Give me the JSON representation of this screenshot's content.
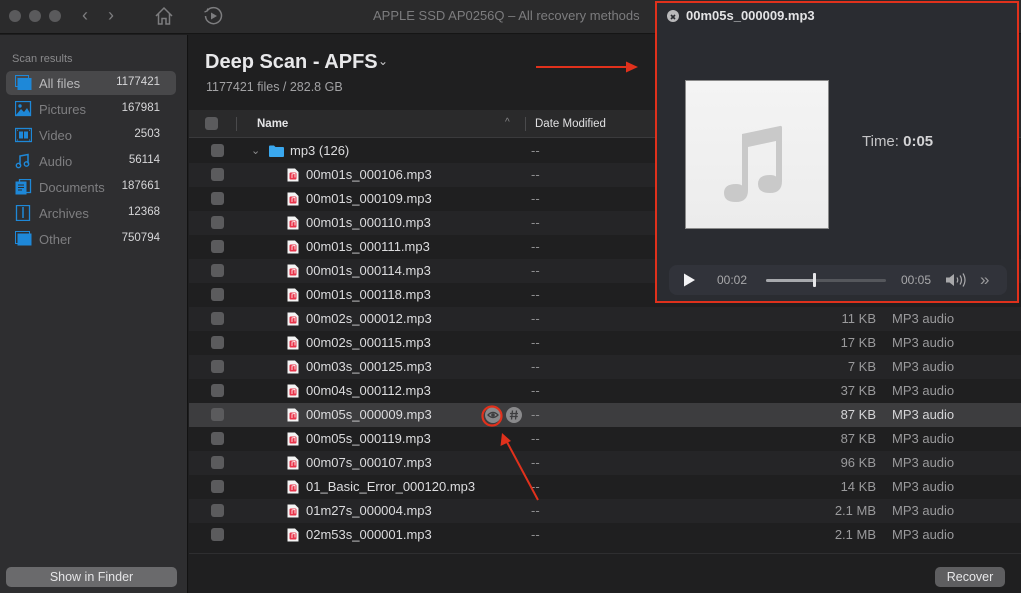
{
  "window": {
    "title": "APPLE SSD AP0256Q – All recovery methods",
    "back_icon": "chevron-left-icon",
    "forward_icon": "chevron-right-icon",
    "home_icon": "home-icon",
    "resume_icon": "play-circle-icon"
  },
  "sidebar": {
    "heading": "Scan results",
    "items": [
      {
        "label": "All files",
        "count": "1177421",
        "icon": "all-files-icon",
        "active": true
      },
      {
        "label": "Pictures",
        "count": "167981",
        "icon": "pictures-icon"
      },
      {
        "label": "Video",
        "count": "2503",
        "icon": "video-icon"
      },
      {
        "label": "Audio",
        "count": "56114",
        "icon": "audio-icon"
      },
      {
        "label": "Documents",
        "count": "187661",
        "icon": "documents-icon"
      },
      {
        "label": "Archives",
        "count": "12368",
        "icon": "archives-icon"
      },
      {
        "label": "Other",
        "count": "750794",
        "icon": "other-icon"
      }
    ],
    "show_in_finder": "Show in Finder"
  },
  "main": {
    "title": "Deep Scan - APFS",
    "title_chevron": "⌄",
    "subtitle": "1177421 files / 282.8 GB",
    "columns": {
      "name": "Name",
      "date": "Date Modified",
      "sort_indicator": "^"
    },
    "folder": {
      "name": "mp3 (126)",
      "date": "--"
    },
    "files": [
      {
        "name": "00m01s_000106.mp3",
        "date": "--",
        "size": "",
        "kind": ""
      },
      {
        "name": "00m01s_000109.mp3",
        "date": "--",
        "size": "",
        "kind": ""
      },
      {
        "name": "00m01s_000110.mp3",
        "date": "--",
        "size": "",
        "kind": ""
      },
      {
        "name": "00m01s_000111.mp3",
        "date": "--",
        "size": "",
        "kind": ""
      },
      {
        "name": "00m01s_000114.mp3",
        "date": "--",
        "size": "",
        "kind": ""
      },
      {
        "name": "00m01s_000118.mp3",
        "date": "--",
        "size": "",
        "kind": ""
      },
      {
        "name": "00m02s_000012.mp3",
        "date": "--",
        "size": "11 KB",
        "kind": "MP3 audio"
      },
      {
        "name": "00m02s_000115.mp3",
        "date": "--",
        "size": "17 KB",
        "kind": "MP3 audio"
      },
      {
        "name": "00m03s_000125.mp3",
        "date": "--",
        "size": "7 KB",
        "kind": "MP3 audio"
      },
      {
        "name": "00m04s_000112.mp3",
        "date": "--",
        "size": "37 KB",
        "kind": "MP3 audio"
      },
      {
        "name": "00m05s_000009.mp3",
        "date": "--",
        "size": "87 KB",
        "kind": "MP3 audio",
        "selected": true
      },
      {
        "name": "00m05s_000119.mp3",
        "date": "--",
        "size": "87 KB",
        "kind": "MP3 audio"
      },
      {
        "name": "00m07s_000107.mp3",
        "date": "--",
        "size": "96 KB",
        "kind": "MP3 audio"
      },
      {
        "name": "01_Basic_Error_000120.mp3",
        "date": "--",
        "size": "14 KB",
        "kind": "MP3 audio"
      },
      {
        "name": "01m27s_000004.mp3",
        "date": "--",
        "size": "2.1 MB",
        "kind": "MP3 audio"
      },
      {
        "name": "02m53s_000001.mp3",
        "date": "--",
        "size": "2.1 MB",
        "kind": "MP3 audio"
      }
    ],
    "recover": "Recover"
  },
  "preview": {
    "title": "00m05s_000009.mp3",
    "time_label": "Time:",
    "time_value": "0:05",
    "current": "00:02",
    "duration": "00:05",
    "progress": 0.4,
    "skip": "»"
  },
  "colors": {
    "accent_blue": "#1e88d8",
    "annotation_red": "#e0311c",
    "file_icon_red": "#e8344a"
  }
}
